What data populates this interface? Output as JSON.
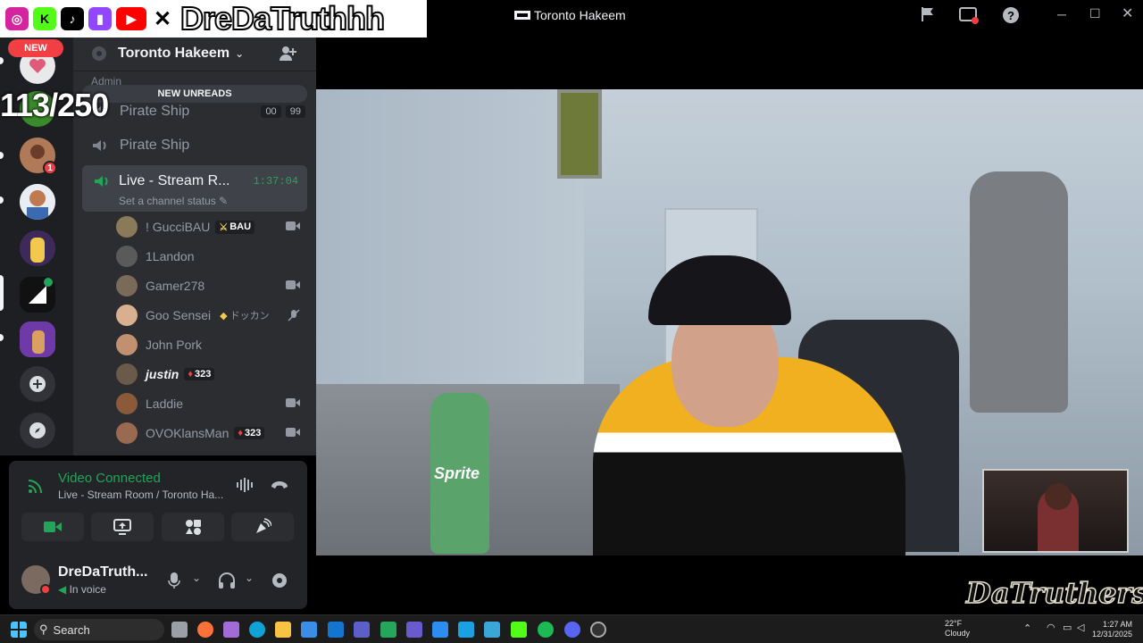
{
  "overlay": {
    "handle": "DreDaTruthhh",
    "counter": "113/250",
    "new_badge": "NEW",
    "social_icons": [
      "instagram-icon",
      "kick-icon",
      "tiktok-icon",
      "twitch-icon",
      "youtube-icon",
      "x-icon"
    ]
  },
  "titlebar": {
    "title": "Toronto Hakeem"
  },
  "server": {
    "name": "Toronto Hakeem",
    "new_unreads": "NEW UNREADS",
    "category": "Admin",
    "channels": [
      {
        "name": "Pirate Ship",
        "tags": [
          "00",
          "99"
        ]
      },
      {
        "name": "Pirate Ship"
      }
    ],
    "live_channel": {
      "name": "Live - Stream R...",
      "timer": "1:37:04",
      "status": "Set a channel status"
    },
    "members": [
      {
        "name": "! GucciBAU",
        "badge": "BAU",
        "icon": "camera-icon"
      },
      {
        "name": "1Landon"
      },
      {
        "name": "Gamer278",
        "icon": "camera-icon"
      },
      {
        "name": "Goo Sensei",
        "badge": "ドッカン",
        "icon": "muted-icon"
      },
      {
        "name": "John Pork"
      },
      {
        "name": "justin",
        "badge": "323"
      },
      {
        "name": "Laddie",
        "icon": "camera-icon"
      },
      {
        "name": "OVOKlansMan",
        "badge": "323",
        "icon": "camera-icon"
      }
    ],
    "server_badge_count": "1"
  },
  "voice": {
    "title": "Video Connected",
    "subtitle": "Live - Stream Room / Toronto Ha...",
    "buttons": [
      "camera-icon",
      "screen-share-icon",
      "activities-icon",
      "soundboard-icon"
    ]
  },
  "user": {
    "name": "DreDaTruth...",
    "status": "In voice"
  },
  "stream": {
    "bottle_label": "Sprite",
    "watermark": "DaTruthers"
  },
  "taskbar": {
    "search": "Search",
    "weather_temp": "22°F",
    "weather_desc": "Cloudy",
    "time": "1:27 AM",
    "date": "12/31/2025"
  },
  "colors": {
    "green": "#23a559",
    "red": "#f23f43",
    "panel": "#2b2d31"
  }
}
